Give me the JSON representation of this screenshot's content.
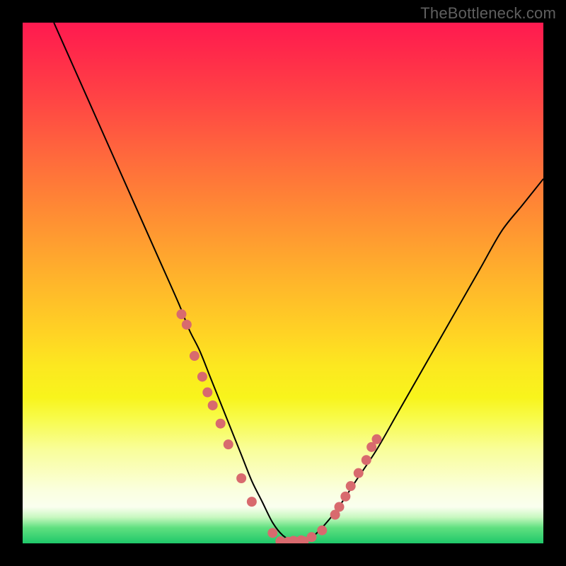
{
  "watermark": "TheBottleneck.com",
  "chart_data": {
    "type": "line",
    "title": "",
    "xlabel": "",
    "ylabel": "",
    "xlim": [
      0,
      100
    ],
    "ylim": [
      0,
      100
    ],
    "background_gradient": {
      "top": "#ff1a50",
      "mid": "#ffd424",
      "bottom": "#1fc86a"
    },
    "series": [
      {
        "name": "bottleneck-curve",
        "stroke": "#000000",
        "x": [
          6,
          10,
          14,
          18,
          22,
          26,
          30,
          32,
          34,
          36,
          38,
          40,
          42,
          44,
          46,
          48,
          50,
          52,
          54,
          56,
          60,
          64,
          68,
          72,
          76,
          80,
          84,
          88,
          92,
          96,
          100
        ],
        "y": [
          100,
          91,
          82,
          73,
          64,
          55,
          46,
          41,
          37,
          32,
          27,
          22,
          17,
          12,
          8,
          4,
          1.5,
          0.5,
          0.3,
          1.5,
          6,
          12,
          18,
          25,
          32,
          39,
          46,
          53,
          60,
          65,
          70
        ]
      }
    ],
    "points_left": {
      "name": "dots-left-branch",
      "color": "#d86a6e",
      "x": [
        30.5,
        31.5,
        33.0,
        34.5,
        35.5,
        36.5,
        38.0,
        39.5,
        42.0,
        44.0,
        48.0
      ],
      "y": [
        44.0,
        42.0,
        36.0,
        32.0,
        29.0,
        26.5,
        23.0,
        19.0,
        12.5,
        8.0,
        2.0
      ]
    },
    "points_right": {
      "name": "dots-right-branch",
      "color": "#d86a6e",
      "x": [
        52.0,
        53.5,
        55.5,
        57.5,
        60.0,
        60.8,
        62.0,
        63.0,
        64.5,
        66.0,
        67.0,
        68.0
      ],
      "y": [
        0.5,
        0.6,
        1.2,
        2.5,
        5.5,
        7.0,
        9.0,
        11.0,
        13.5,
        16.0,
        18.5,
        20.0
      ]
    },
    "points_bottom": {
      "name": "dots-valley",
      "color": "#d86a6e",
      "x": [
        49.5,
        51.0,
        52.5,
        54.0
      ],
      "y": [
        0.4,
        0.3,
        0.3,
        0.4
      ]
    }
  }
}
